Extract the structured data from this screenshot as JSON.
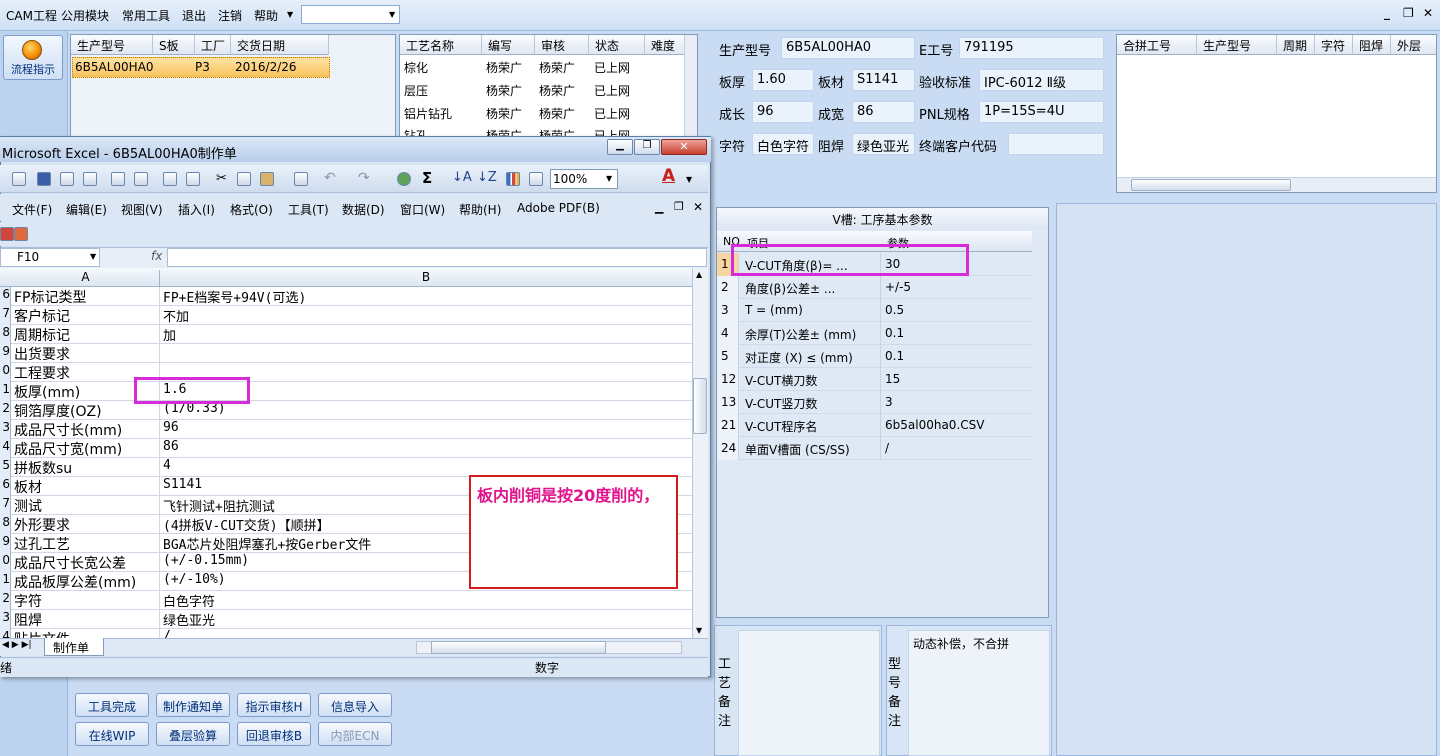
{
  "menubar": {
    "items": [
      "CAM工程",
      "公用模块",
      "常用工具",
      "退出",
      "注销",
      "帮助"
    ],
    "dropdown_value": "",
    "window_controls": [
      "_",
      "❐",
      "✕"
    ]
  },
  "left": {
    "flow_button": "流程指示"
  },
  "order_grid": {
    "columns": [
      "生产型号",
      "S板",
      "工厂",
      "交货日期"
    ],
    "rows": [
      [
        "6B5AL00HA0",
        "",
        "P3",
        "2016/2/26"
      ]
    ]
  },
  "process_grid": {
    "columns": [
      "工艺名称",
      "编写",
      "审核",
      "状态",
      "难度"
    ],
    "rows": [
      [
        "棕化",
        "杨荣广",
        "杨荣广",
        "已上网",
        ""
      ],
      [
        "层压",
        "杨荣广",
        "杨荣广",
        "已上网",
        ""
      ],
      [
        "铝片钻孔",
        "杨荣广",
        "杨荣广",
        "已上网",
        ""
      ],
      [
        "钻孔",
        "杨荣广",
        "杨荣广",
        "已上网",
        ""
      ]
    ]
  },
  "info": {
    "model_label": "生产型号",
    "model": "6B5AL00HA0",
    "eno_label": "E工号",
    "eno": "791195",
    "thick_label": "板厚",
    "thick": "1.60",
    "material_label": "板材",
    "material": "S1141",
    "std_label": "验收标准",
    "std": "IPC-6012 Ⅱ级",
    "len_label": "成长",
    "len": "96",
    "wid_label": "成宽",
    "wid": "86",
    "pnl_label": "PNL规格",
    "pnl": "1P=15S=4U",
    "char_label": "字符",
    "char": "白色字符",
    "mask_label": "阻焊",
    "mask": "绿色亚光",
    "cust_label": "终端客户代码",
    "cust": ""
  },
  "panel_grid": {
    "columns": [
      "合拼工号",
      "生产型号",
      "周期",
      "字符",
      "阻焊",
      "外层"
    ]
  },
  "vcut": {
    "title": "V槽: 工序基本参数",
    "col_no": "NO",
    "col_item": "项目",
    "col_param": "参数",
    "rows": [
      {
        "no": "1",
        "item": "V-CUT角度(β)=  ...",
        "value": "30"
      },
      {
        "no": "2",
        "item": "角度(β)公差±  ...",
        "value": "+/-5"
      },
      {
        "no": "3",
        "item": "T =  (mm)",
        "value": "0.5"
      },
      {
        "no": "4",
        "item": "余厚(T)公差±  (mm)",
        "value": "0.1"
      },
      {
        "no": "5",
        "item": "对正度 (X) ≤ (mm)",
        "value": "0.1"
      },
      {
        "no": "12",
        "item": "V-CUT横刀数",
        "value": "15"
      },
      {
        "no": "13",
        "item": "V-CUT竖刀数",
        "value": "3"
      },
      {
        "no": "21",
        "item": "V-CUT程序名",
        "value": "6b5al00ha0.CSV"
      },
      {
        "no": "24",
        "item": "单面V槽面 (CS/SS)",
        "value": "/"
      }
    ]
  },
  "remarks": {
    "process_label": [
      "工",
      "艺",
      "备",
      "注"
    ],
    "model_label": [
      "型",
      "号",
      "备",
      "注"
    ],
    "model_text": "动态补偿，不合拼"
  },
  "bottom_buttons": [
    [
      "工具完成",
      "制作通知单",
      "指示审核H",
      "信息导入"
    ],
    [
      "在线WIP",
      "叠层验算",
      "回退审核B",
      "内部ECN"
    ]
  ],
  "excel": {
    "title": "Microsoft Excel - 6B5AL00HA0制作单",
    "zoom": "100%",
    "menu": [
      "文件(F)",
      "编辑(E)",
      "视图(V)",
      "插入(I)",
      "格式(O)",
      "工具(T)",
      "数据(D)",
      "窗口(W)",
      "帮助(H)",
      "Adobe PDF(B)"
    ],
    "name_box": "F10",
    "fx": "fx",
    "col_a": "A",
    "col_b": "B",
    "rows": [
      {
        "n": "6",
        "a": "FP标记类型",
        "b": "FP+E档案号+94V(可选)"
      },
      {
        "n": "7",
        "a": "客户标记",
        "b": "不加"
      },
      {
        "n": "8",
        "a": "周期标记",
        "b": "加"
      },
      {
        "n": "9",
        "a": "出货要求",
        "b": ""
      },
      {
        "n": "0",
        "a": "工程要求",
        "b": ""
      },
      {
        "n": "1",
        "a": "板厚(mm)",
        "b": "1.6"
      },
      {
        "n": "2",
        "a": "铜箔厚度(OZ)",
        "b": "(1/0.33)"
      },
      {
        "n": "3",
        "a": "成品尺寸长(mm)",
        "b": "96"
      },
      {
        "n": "4",
        "a": "成品尺寸宽(mm)",
        "b": "86"
      },
      {
        "n": "5",
        "a": "拼板数su",
        "b": "4"
      },
      {
        "n": "6",
        "a": "板材",
        "b": "S1141"
      },
      {
        "n": "7",
        "a": "测试",
        "b": "飞针测试+阻抗测试"
      },
      {
        "n": "8",
        "a": "外形要求",
        "b": "(4拼板V-CUT交货)【顺拼】"
      },
      {
        "n": "9",
        "a": "过孔工艺",
        "b": "BGA芯片处阻焊塞孔+按Gerber文件"
      },
      {
        "n": "0",
        "a": "成品尺寸长宽公差",
        "b": "(+/-0.15mm)"
      },
      {
        "n": "1",
        "a": "成品板厚公差(mm)",
        "b": "(+/-10%)"
      },
      {
        "n": "2",
        "a": "字符",
        "b": "白色字符"
      },
      {
        "n": "3",
        "a": "阻焊",
        "b": "绿色亚光"
      },
      {
        "n": "4",
        "a": "贴片文件",
        "b": "/"
      }
    ],
    "sheet_tab": "制作单",
    "status_left": "绪",
    "status_num": "数字"
  },
  "annotation": {
    "text": "板内削铜是按20度削的，"
  },
  "colors": {
    "highlight": "#d82ad8",
    "note_border": "#d21c1c",
    "note_text": "#e0148c"
  }
}
